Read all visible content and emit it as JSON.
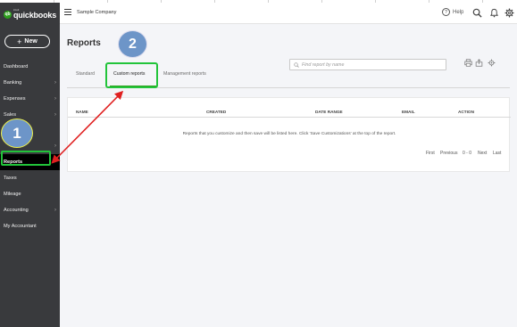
{
  "app": {
    "logo_small": "intuit",
    "logo_word": "quickbooks",
    "logo_mark": "qb",
    "company": "Sample Company"
  },
  "sidebar": {
    "new_label": "New",
    "items": [
      {
        "label": "Dashboard",
        "chevron": false
      },
      {
        "label": "Banking",
        "chevron": true
      },
      {
        "label": "Expenses",
        "chevron": true
      },
      {
        "label": "Sales",
        "chevron": true
      },
      {
        "label": "",
        "chevron": false
      },
      {
        "label": "",
        "chevron": true
      },
      {
        "label": "Reports",
        "chevron": false,
        "active": true
      },
      {
        "label": "Taxes",
        "chevron": false
      },
      {
        "label": "Mileage",
        "chevron": false
      },
      {
        "label": "Accounting",
        "chevron": true
      },
      {
        "label": "My Accountant",
        "chevron": false
      }
    ]
  },
  "header": {
    "help_label": "Help",
    "help_icon_glyph": "?"
  },
  "page": {
    "title": "Reports",
    "search_placeholder": "Find report by name",
    "tabs": [
      "Standard",
      "Custom reports",
      "Management reports"
    ],
    "active_tab": "Custom reports"
  },
  "table": {
    "columns": [
      "NAME",
      "CREATED",
      "DATE RANGE",
      "EMAIL",
      "ACTION"
    ],
    "empty_message": "Reports that you customize and then save will be listed here. Click 'Save Customizations' at the top of the report."
  },
  "pager": {
    "first": "First",
    "previous": "Previous",
    "range": "0 - 0",
    "next": "Next",
    "last": "Last"
  },
  "annotations": {
    "step1": "1",
    "step2": "2",
    "highlight_color": "#22c43a",
    "arrow_color": "#e02020",
    "circle_color": "#6d95c8"
  },
  "colors": {
    "brand": "#2ca01c",
    "sidebar_bg": "#393a3d",
    "main_bg": "#f4f5f8"
  }
}
